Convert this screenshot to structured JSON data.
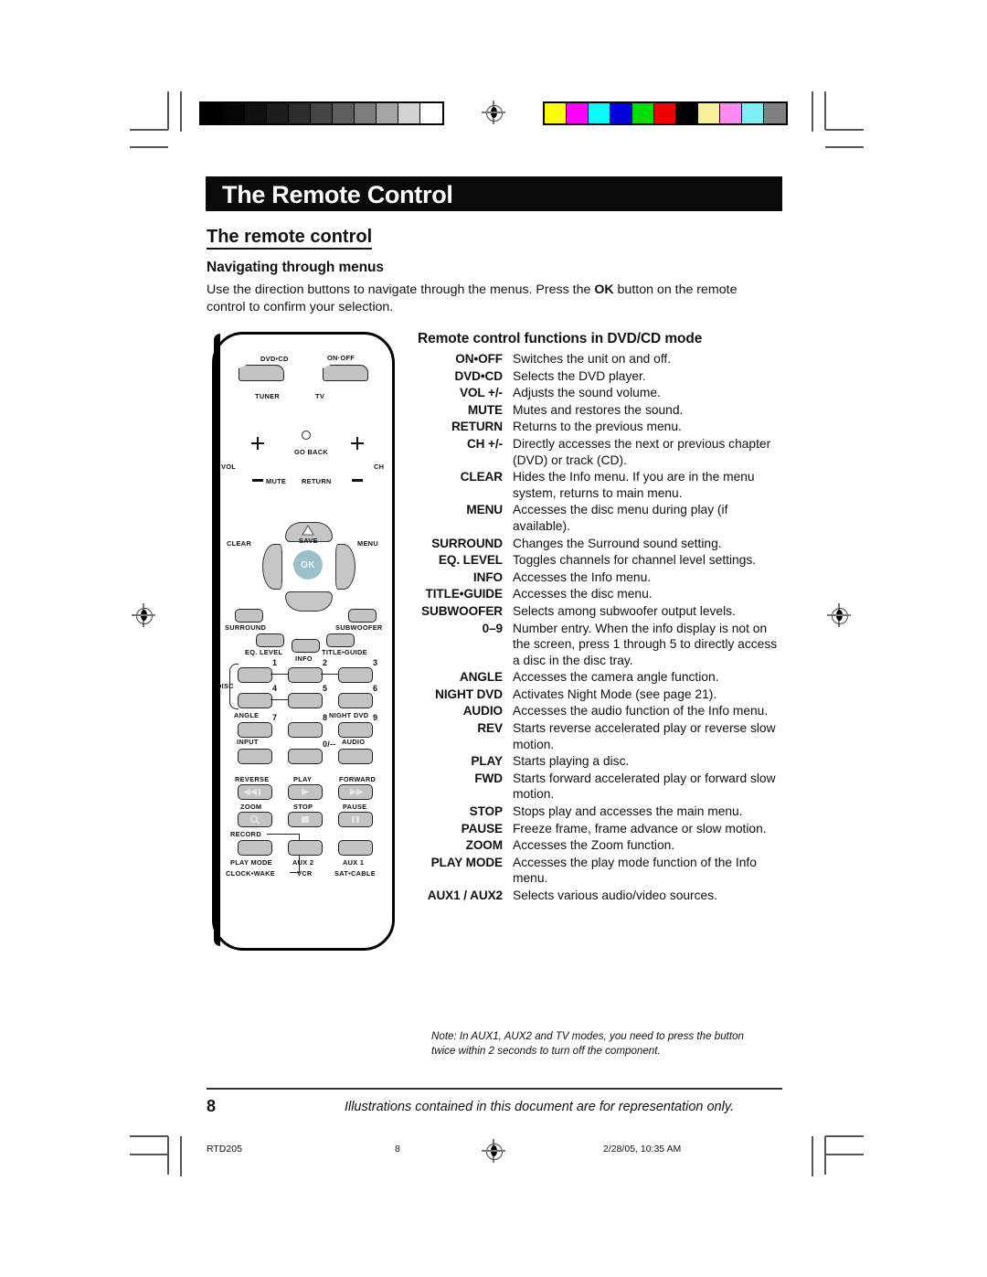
{
  "page": {
    "title": "The Remote Control",
    "section_heading": "The remote control",
    "subsection_heading": "Navigating through menus",
    "intro_before": "Use the direction buttons to navigate through the menus. Press the ",
    "intro_bold": "OK",
    "intro_after": " button on the remote control to confirm your selection.",
    "page_number": "8",
    "footer_caption": "Illustrations contained in this document are for representation only.",
    "footer_left": "RTD205",
    "footer_center": "8",
    "footer_right": "2/28/05, 10:35 AM"
  },
  "functions": {
    "heading": "Remote control functions in DVD/CD mode",
    "rows": [
      {
        "term": "ON•OFF",
        "desc": "Switches the unit on and off."
      },
      {
        "term": "DVD•CD",
        "desc": "Selects the DVD player."
      },
      {
        "term": "VOL +/-",
        "desc": "Adjusts the sound volume."
      },
      {
        "term": "MUTE",
        "desc": "Mutes and restores the sound."
      },
      {
        "term": "RETURN",
        "desc": "Returns to the previous menu."
      },
      {
        "term": "CH  +/-",
        "desc": "Directly accesses the next or previous chapter (DVD) or track (CD)."
      },
      {
        "term": "CLEAR",
        "desc": "Hides the Info menu. If you are in the menu system, returns to main menu."
      },
      {
        "term": "MENU",
        "desc": "Accesses the disc menu during play (if available)."
      },
      {
        "term": "SURROUND",
        "desc": "Changes the Surround sound setting."
      },
      {
        "term": "EQ. LEVEL",
        "desc": "Toggles channels for channel level settings."
      },
      {
        "term": "INFO",
        "desc": "Accesses the Info menu."
      },
      {
        "term": "TITLE•GUIDE",
        "desc": "Accesses the disc menu."
      },
      {
        "term": "SUBWOOFER",
        "desc": "Selects among subwoofer output levels."
      },
      {
        "term": "0–9",
        "desc": "Number entry. When the info display is not on the screen, press 1 through 5 to directly access a disc in the disc tray."
      },
      {
        "term": "ANGLE",
        "desc": "Accesses the camera angle function."
      },
      {
        "term": "NIGHT DVD",
        "desc": "Activates Night Mode (see page 21)."
      },
      {
        "term": "AUDIO",
        "desc": "Accesses the audio function of the Info menu."
      },
      {
        "term": "REV",
        "desc": "Starts reverse accelerated play or reverse slow motion."
      },
      {
        "term": "PLAY",
        "desc": "Starts playing a disc."
      },
      {
        "term": "FWD",
        "desc": "Starts forward accelerated play or forward slow motion."
      },
      {
        "term": "STOP",
        "desc": "Stops play and accesses the main menu."
      },
      {
        "term": "PAUSE",
        "desc": "Freeze frame, frame advance or slow motion."
      },
      {
        "term": "ZOOM",
        "desc": "Accesses the Zoom function."
      },
      {
        "term": "PLAY MODE",
        "desc": "Accesses the play mode function of the Info menu."
      },
      {
        "term": "AUX1 / AUX2",
        "desc": "Selects various audio/video sources."
      }
    ],
    "note": "Note: In AUX1, AUX2 and TV modes, you need to press the button twice within 2 seconds to turn off the component."
  },
  "remote_labels": {
    "dvd_cd": "DVD•CD",
    "on_off": "ON·OFF",
    "tuner": "TUNER",
    "tv": "TV",
    "vol": "VOL",
    "ch": "CH",
    "go_back": "GO BACK",
    "mute": "MUTE",
    "return": "RETURN",
    "clear": "CLEAR",
    "menu": "MENU",
    "save": "SAVE",
    "ok": "OK",
    "surround": "SURROUND",
    "subwoofer": "SUBWOOFER",
    "eq_level": "EQ. LEVEL",
    "info": "INFO",
    "title_guide": "TITLE•GUIDE",
    "disc": "DISC",
    "n1": "1",
    "n2": "2",
    "n3": "3",
    "n4": "4",
    "n5": "5",
    "n6": "6",
    "n7": "7",
    "n8": "8",
    "n9": "9",
    "n0": "0/--",
    "angle": "ANGLE",
    "night_dvd": "NIGHT DVD",
    "input": "INPUT",
    "audio": "AUDIO",
    "reverse": "REVERSE",
    "play": "PLAY",
    "forward": "FORWARD",
    "zoom": "ZOOM",
    "stop": "STOP",
    "pause": "PAUSE",
    "record": "RECORD",
    "play_mode": "PLAY MODE",
    "clock_wake": "CLOCK•WAKE",
    "aux2": "AUX 2",
    "vcr": "VCR",
    "aux1": "AUX 1",
    "sat_cable": "SAT•CABLE"
  },
  "colorbars": {
    "gray": [
      "#000000",
      "#060606",
      "#101010",
      "#1d1d1d",
      "#2d2d2d",
      "#454545",
      "#5e5e5e",
      "#7d7d7d",
      "#a5a5a5",
      "#d2d2d2",
      "#ffffff"
    ],
    "color": [
      "#ffff00",
      "#ff00ff",
      "#00ffff",
      "#0000dd",
      "#00dd00",
      "#ee0000",
      "#000000",
      "#f5f09a",
      "#ff8cf0",
      "#7ef0f5",
      "#808080"
    ]
  }
}
